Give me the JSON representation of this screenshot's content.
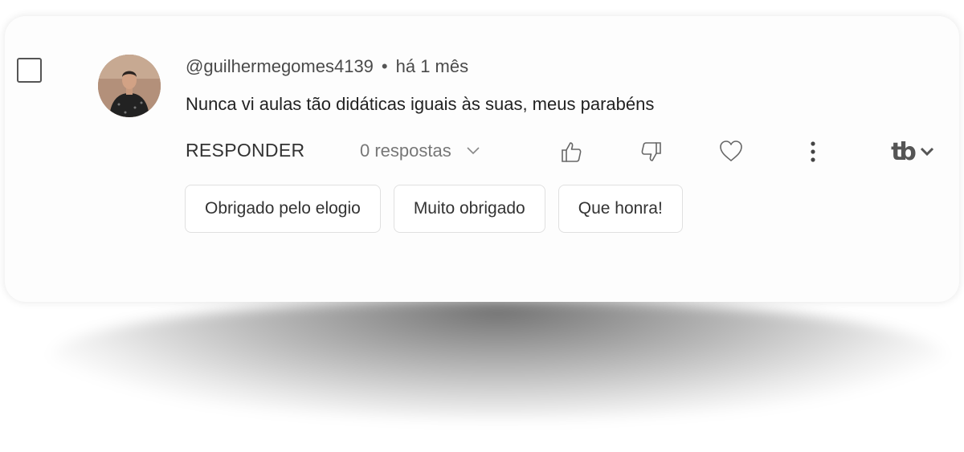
{
  "comment": {
    "author": "@guilhermegomes4139",
    "separator": "•",
    "time": "há 1 mês",
    "text": "Nunca vi aulas tão didáticas iguais às suas, meus parabéns"
  },
  "actions": {
    "reply_label": "RESPONDER",
    "replies_label": "0 respostas",
    "like_icon": "thumbs-up-icon",
    "dislike_icon": "thumbs-down-icon",
    "heart_icon": "heart-icon",
    "more_icon": "more-vertical-icon",
    "extension_label": "tb",
    "extension_chevron": "chevron-down-icon"
  },
  "suggestions": [
    {
      "label": "Obrigado pelo elogio"
    },
    {
      "label": "Muito obrigado"
    },
    {
      "label": "Que honra!"
    }
  ]
}
